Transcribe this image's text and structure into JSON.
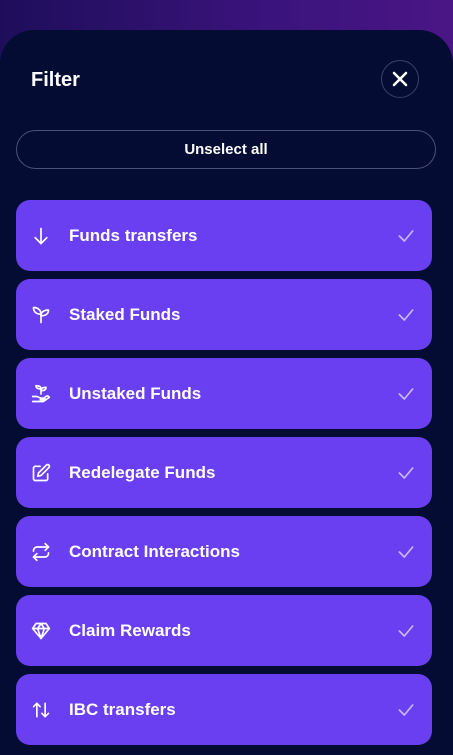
{
  "header": {
    "title": "Filter"
  },
  "actions": {
    "unselect_all_label": "Unselect all"
  },
  "filters": [
    {
      "label": "Funds transfers",
      "icon": "arrow-down-icon",
      "checked": true
    },
    {
      "label": "Staked Funds",
      "icon": "sprout-icon",
      "checked": true
    },
    {
      "label": "Unstaked Funds",
      "icon": "hand-sprout-icon",
      "checked": true
    },
    {
      "label": "Redelegate Funds",
      "icon": "edit-icon",
      "checked": true
    },
    {
      "label": "Contract Interactions",
      "icon": "repeat-icon",
      "checked": true
    },
    {
      "label": "Claim Rewards",
      "icon": "gem-icon",
      "checked": true
    },
    {
      "label": "IBC transfers",
      "icon": "arrows-up-down-icon",
      "checked": true
    }
  ],
  "colors": {
    "sheet_bg": "#040c33",
    "item_bg": "#6a3ff2",
    "check_color": "#c9b9ff"
  }
}
